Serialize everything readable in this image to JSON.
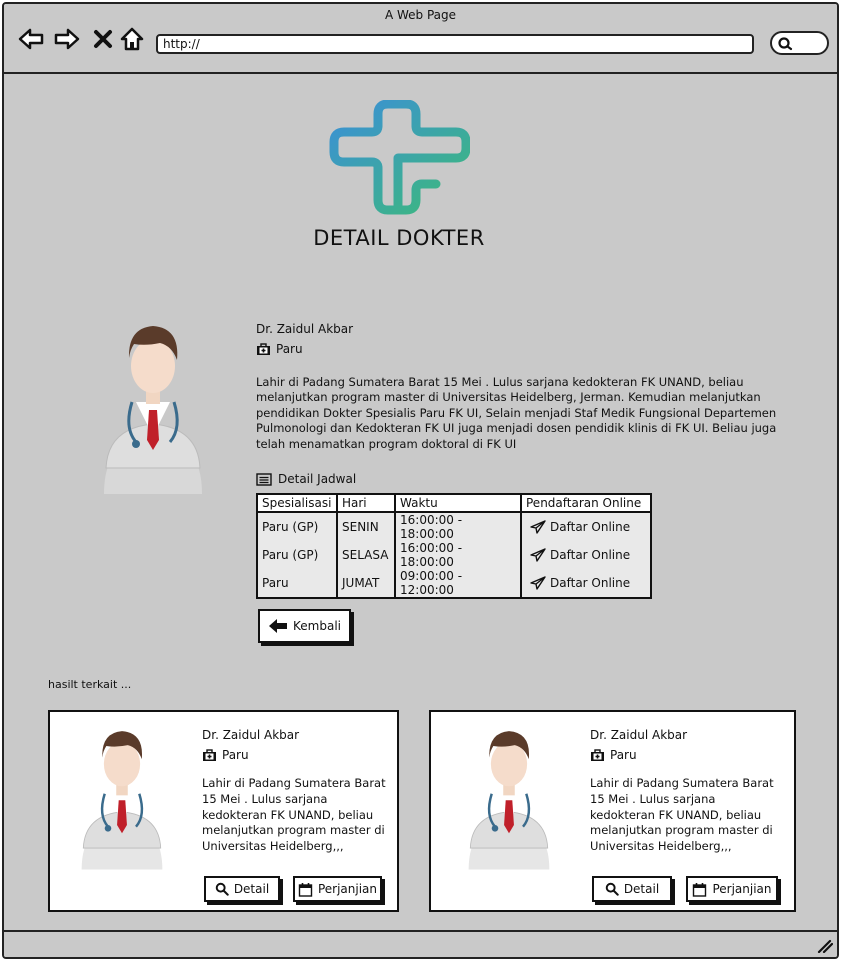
{
  "browser": {
    "window_title": "A Web Page",
    "url": "http://"
  },
  "header": {
    "title": "DETAIL DOKTER"
  },
  "doctor": {
    "name": "Dr. Zaidul Akbar",
    "specialty": "Paru",
    "bio_lines": [
      "Lahir di Padang Sumatera Barat 15 Mei . Lulus sarjana kedokteran FK UNAND, beliau",
      "melanjutkan program master di Universitas Heidelberg, Jerman. Kemudian melanjutkan",
      "pendidikan Dokter Spesialis Paru FK UI, Selain menjadi Staf Medik Fungsional Departemen",
      "Pulmonologi dan Kedokteran FK UI juga menjadi dosen pendidik klinis di FK UI. Beliau juga",
      "telah menamatkan program doktoral di FK UI"
    ]
  },
  "schedule": {
    "heading": "Detail Jadwal",
    "columns": [
      "Spesialisasi",
      "Hari",
      "Waktu",
      "Pendaftaran Online"
    ],
    "rows": [
      {
        "spesialisasi": "Paru (GP)",
        "hari": "SENIN",
        "waktu": "16:00:00 - 18:00:00",
        "action": "Daftar Online"
      },
      {
        "spesialisasi": "Paru (GP)",
        "hari": "SELASA",
        "waktu": "16:00:00 - 18:00:00",
        "action": "Daftar Online"
      },
      {
        "spesialisasi": "Paru",
        "hari": "JUMAT",
        "waktu": "09:00:00 - 12:00:00",
        "action": "Daftar Online"
      }
    ]
  },
  "back_button": {
    "label": "Kembali"
  },
  "related": {
    "label": "hasilt terkait ...",
    "cards": [
      {
        "name": "Dr. Zaidul Akbar",
        "specialty": "Paru",
        "bio_lines": [
          "Lahir di Padang Sumatera Barat",
          "15 Mei . Lulus sarjana",
          "kedokteran FK UNAND, beliau",
          "melanjutkan program master di",
          "Universitas Heidelberg,,,"
        ],
        "detail_label": "Detail",
        "appointment_label": "Perjanjian"
      },
      {
        "name": "Dr. Zaidul Akbar",
        "specialty": "Paru",
        "bio_lines": [
          "Lahir di Padang Sumatera Barat",
          "15 Mei . Lulus sarjana",
          "kedokteran FK UNAND, beliau",
          "melanjutkan program master di",
          "Universitas Heidelberg,,,"
        ],
        "detail_label": "Detail",
        "appointment_label": "Perjanjian"
      }
    ]
  },
  "icons": {
    "back": "arrow-left-icon",
    "forward": "arrow-right-icon",
    "stop": "close-icon",
    "home": "home-icon",
    "search": "search-icon",
    "specialty": "medical-kit-icon",
    "schedule": "list-icon",
    "register": "send-icon",
    "kembali": "arrow-left-icon",
    "detail": "search-icon",
    "appointment": "calendar-icon"
  },
  "colors": {
    "window_bg": "#c9c9c9",
    "logo_blue": "#3b8fd8",
    "logo_green": "#3dbb78",
    "tie_red": "#c0202a"
  }
}
